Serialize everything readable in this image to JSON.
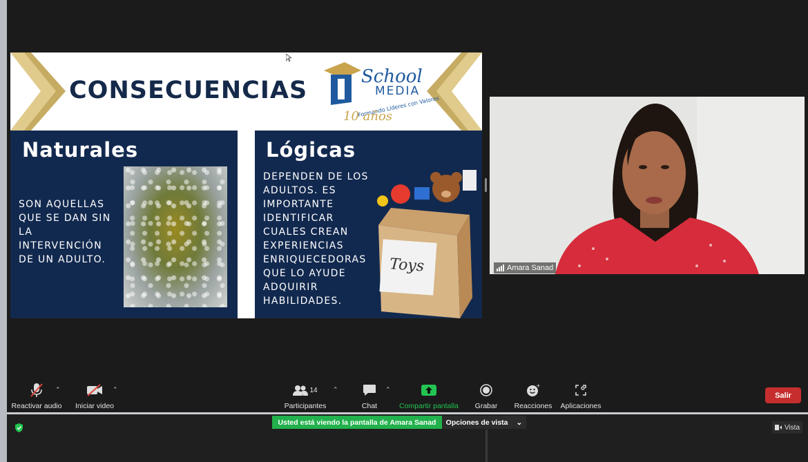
{
  "slide": {
    "title": "CONSECUENCIAS",
    "logo": {
      "school": "School",
      "media": "MEDIA",
      "years": "10 años",
      "tagline": "Formando Líderes con Valores"
    },
    "left_panel": {
      "heading": "Naturales",
      "text": "SON AQUELLAS\nQUE SE DAN SIN\nLA\nINTERVENCIÓN\nDE UN ADULTO."
    },
    "right_panel": {
      "heading": "Lógicas",
      "text": "DEPENDEN DE LOS\nADULTOS. ES\nIMPORTANTE\nIDENTIFICAR\nCUALES CREAN\nEXPERIENCIAS\nENRIQUECEDORAS\nQUE LO AYUDE\nADQUIRIR\nHABILIDADES.",
      "box_label": "Toys"
    }
  },
  "video": {
    "participant_name": "Amara Sanad"
  },
  "toolbar": {
    "audio_label": "Reactivar audio",
    "video_label": "Iniciar video",
    "participants_label": "Participantes",
    "participants_count": "14",
    "chat_label": "Chat",
    "share_label": "Compartir pantalla",
    "record_label": "Grabar",
    "reactions_label": "Reacciones",
    "apps_label": "Aplicaciones",
    "leave_label": "Salir",
    "share_color": "#23c552",
    "leave_color": "#c62e2e"
  },
  "bottom_bar": {
    "viewing_text": "Usted está viendo la pantalla de Amara Sanad",
    "view_options_label": "Opciones de vista",
    "view_label": "Vista"
  }
}
